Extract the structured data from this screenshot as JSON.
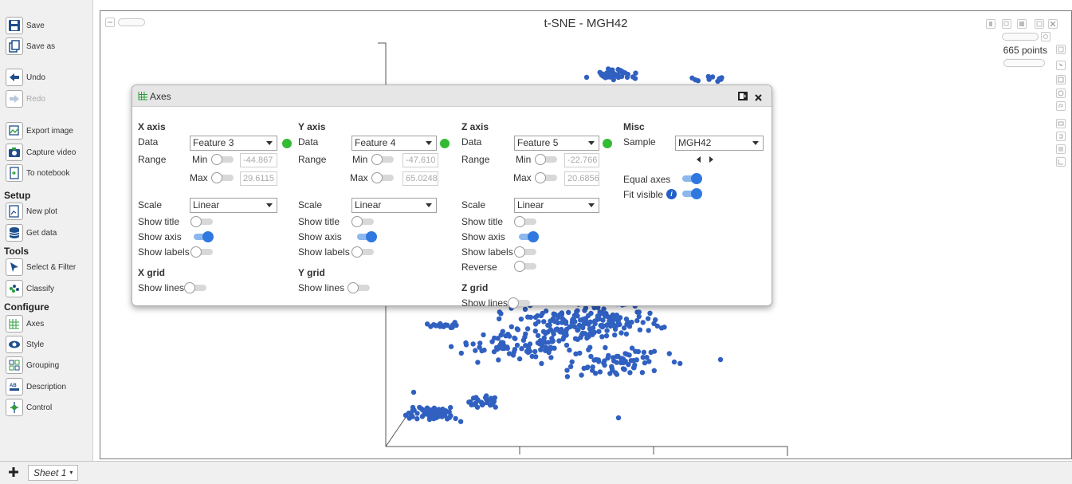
{
  "sidebar": {
    "save": "Save",
    "save_as": "Save as",
    "undo": "Undo",
    "redo": "Redo",
    "export_image": "Export image",
    "capture_video": "Capture video",
    "to_notebook": "To notebook",
    "setup_heading": "Setup",
    "new_plot": "New plot",
    "get_data": "Get data",
    "tools_heading": "Tools",
    "select_filter": "Select & Filter",
    "classify": "Classify",
    "configure_heading": "Configure",
    "axes": "Axes",
    "style": "Style",
    "grouping": "Grouping",
    "description": "Description",
    "control": "Control"
  },
  "plot": {
    "title": "t-SNE - MGH42",
    "point_count": "665 points",
    "point_color": "#3060c0"
  },
  "axes_dialog": {
    "title": "Axes",
    "x_axis": {
      "heading": "X axis",
      "data_label": "Data",
      "data_value": "Feature 3",
      "range_label": "Range",
      "min_label": "Min",
      "min_value": "-44.867",
      "max_label": "Max",
      "max_value": "29.6115",
      "scale_label": "Scale",
      "scale_value": "Linear",
      "show_title_label": "Show title",
      "show_title": false,
      "show_axis_label": "Show axis",
      "show_axis": true,
      "show_labels_label": "Show labels",
      "show_labels": false,
      "grid_heading": "X grid",
      "show_lines_label": "Show lines",
      "show_lines": false
    },
    "y_axis": {
      "heading": "Y axis",
      "data_label": "Data",
      "data_value": "Feature 4",
      "range_label": "Range",
      "min_label": "Min",
      "min_value": "-47.610",
      "max_label": "Max",
      "max_value": "65.0248",
      "scale_label": "Scale",
      "scale_value": "Linear",
      "show_title_label": "Show title",
      "show_title": false,
      "show_axis_label": "Show axis",
      "show_axis": true,
      "show_labels_label": "Show labels",
      "show_labels": false,
      "grid_heading": "Y grid",
      "show_lines_label": "Show lines",
      "show_lines": false
    },
    "z_axis": {
      "heading": "Z axis",
      "data_label": "Data",
      "data_value": "Feature 5",
      "range_label": "Range",
      "min_label": "Min",
      "min_value": "-22.766",
      "max_label": "Max",
      "max_value": "20.6856",
      "scale_label": "Scale",
      "scale_value": "Linear",
      "show_title_label": "Show title",
      "show_title": false,
      "show_axis_label": "Show axis",
      "show_axis": true,
      "show_labels_label": "Show labels",
      "show_labels": false,
      "reverse_label": "Reverse",
      "reverse": false,
      "grid_heading": "Z grid",
      "show_lines_label": "Show lines",
      "show_lines": false
    },
    "misc": {
      "heading": "Misc",
      "sample_label": "Sample",
      "sample_value": "MGH42",
      "equal_axes_label": "Equal axes",
      "equal_axes": true,
      "fit_visible_label": "Fit visible",
      "fit_visible": true
    }
  },
  "sheet": {
    "tab_label": "Sheet 1"
  }
}
